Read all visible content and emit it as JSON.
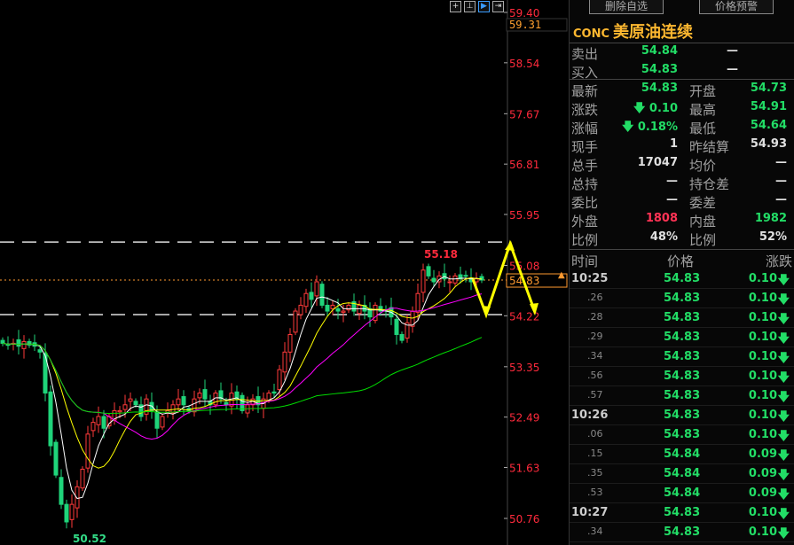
{
  "toolbar": {
    "icons": [
      "crosshair-icon",
      "axis-icon",
      "play-icon",
      "step-icon"
    ]
  },
  "chart_data": {
    "type": "candlestick",
    "yticks": [
      "59.40",
      "58.54",
      "57.67",
      "56.81",
      "55.95",
      "55.08",
      "54.22",
      "53.35",
      "52.49",
      "51.63",
      "50.76"
    ],
    "ylim": [
      50.76,
      59.4
    ],
    "cursor_price": "59.31",
    "current_price": "54.83",
    "high_label": "55.18",
    "low_label": "50.52",
    "resistance": 55.48,
    "support": 54.24,
    "closes": [
      53.75,
      53.72,
      53.75,
      53.7,
      53.78,
      53.72,
      53.7,
      53.6,
      52.9,
      52.0,
      51.5,
      51.0,
      50.7,
      51.0,
      51.3,
      51.6,
      52.2,
      52.4,
      52.5,
      52.3,
      52.5,
      52.6,
      52.6,
      52.7,
      52.8,
      52.7,
      52.5,
      52.8,
      52.6,
      52.3,
      52.5,
      52.6,
      52.7,
      52.8,
      52.7,
      52.6,
      52.8,
      52.9,
      52.8,
      52.7,
      52.9,
      52.8,
      52.7,
      52.9,
      52.8,
      52.6,
      52.7,
      52.8,
      52.7,
      52.8,
      52.9,
      52.9,
      53.3,
      53.6,
      53.9,
      54.3,
      54.4,
      54.6,
      54.5,
      54.8,
      54.4,
      54.3,
      54.4,
      54.3,
      54.3,
      54.4,
      54.3,
      54.4,
      54.3,
      54.2,
      54.4,
      54.3,
      54.3,
      54.2,
      53.9,
      53.8,
      54.1,
      54.3,
      54.6,
      55.0,
      54.9,
      54.8,
      54.9,
      54.85,
      54.8,
      54.9,
      54.85,
      54.9,
      54.8,
      54.85,
      54.83
    ],
    "ma_periods": [
      5,
      10,
      20,
      60
    ],
    "ma_colors": [
      "#ffffff",
      "#ffff00",
      "#ff00ff",
      "#00dd00"
    ]
  },
  "panel": {
    "btn_delete": "删除自选",
    "btn_alert": "价格预警",
    "code": "CONC",
    "name": "美原油连续",
    "quote": [
      {
        "l": "卖出",
        "v": "54.84",
        "c": "g",
        "l2": "",
        "v2": "—"
      },
      {
        "l": "买入",
        "v": "54.83",
        "c": "g",
        "l2": "",
        "v2": "—"
      }
    ],
    "stats": [
      {
        "l": "最新",
        "v": "54.83",
        "c": "g",
        "l2": "开盘",
        "v2": "54.73",
        "c2": "g"
      },
      {
        "l": "涨跌",
        "v": "🡇 0.10",
        "c": "g",
        "l2": "最高",
        "v2": "54.91",
        "c2": "g"
      },
      {
        "l": "涨幅",
        "v": "🡇 0.18%",
        "c": "g",
        "l2": "最低",
        "v2": "54.64",
        "c2": "g"
      },
      {
        "l": "现手",
        "v": "1",
        "c": "w",
        "l2": "昨结算",
        "v2": "54.93",
        "c2": "w"
      },
      {
        "l": "总手",
        "v": "17047",
        "c": "w",
        "l2": "均价",
        "v2": "—",
        "c2": "w"
      },
      {
        "l": "总持",
        "v": "—",
        "c": "w",
        "l2": "持仓差",
        "v2": "—",
        "c2": "w"
      },
      {
        "l": "委比",
        "v": "—",
        "c": "w",
        "l2": "委差",
        "v2": "—",
        "c2": "w"
      },
      {
        "l": "外盘",
        "v": "1808",
        "c": "r",
        "l2": "内盘",
        "v2": "1982",
        "c2": "g"
      },
      {
        "l": "比例",
        "v": "48%",
        "c": "w",
        "l2": "比例",
        "v2": "52%",
        "c2": "w"
      }
    ],
    "ticks_header": {
      "time": "时间",
      "price": "价格",
      "change": "涨跌"
    },
    "ticks": [
      {
        "t": "10:25",
        "p": "54.83",
        "c": "0.10"
      },
      {
        "t": ".26",
        "p": "54.83",
        "c": "0.10"
      },
      {
        "t": ".28",
        "p": "54.83",
        "c": "0.10"
      },
      {
        "t": ".29",
        "p": "54.83",
        "c": "0.10"
      },
      {
        "t": ".34",
        "p": "54.83",
        "c": "0.10"
      },
      {
        "t": ".56",
        "p": "54.83",
        "c": "0.10"
      },
      {
        "t": ".57",
        "p": "54.83",
        "c": "0.10"
      },
      {
        "t": "10:26",
        "p": "54.83",
        "c": "0.10"
      },
      {
        "t": ".06",
        "p": "54.83",
        "c": "0.10"
      },
      {
        "t": ".15",
        "p": "54.84",
        "c": "0.09"
      },
      {
        "t": ".35",
        "p": "54.84",
        "c": "0.09"
      },
      {
        "t": ".53",
        "p": "54.84",
        "c": "0.09"
      },
      {
        "t": "10:27",
        "p": "54.83",
        "c": "0.10"
      },
      {
        "t": ".34",
        "p": "54.83",
        "c": "0.10"
      }
    ]
  }
}
